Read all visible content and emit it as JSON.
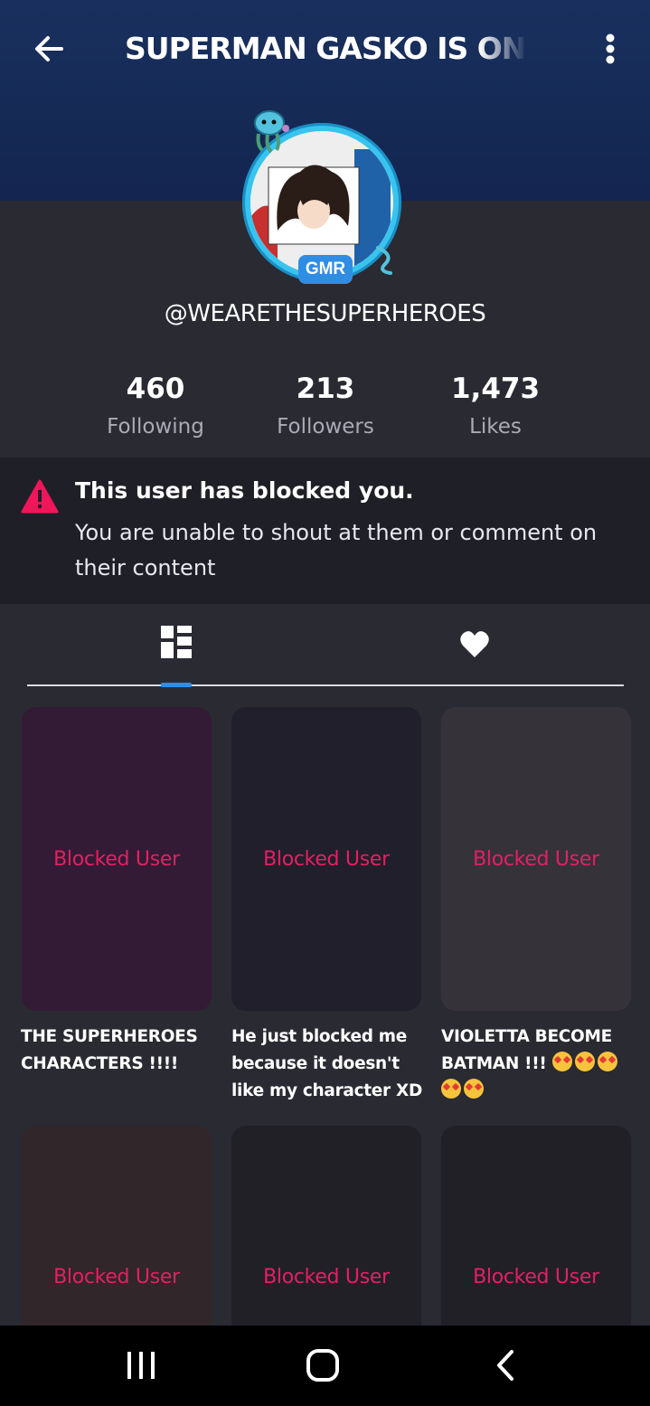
{
  "header": {
    "title": "SUPERMAN GASKO IS ON",
    "back_icon": "arrow-left-icon",
    "menu_icon": "more-vert-icon",
    "background": "#19305e"
  },
  "profile": {
    "badge": "GMR",
    "username": "@WEARETHESUPERHEROES"
  },
  "stats": [
    {
      "value": "460",
      "label": "Following"
    },
    {
      "value": "213",
      "label": "Followers"
    },
    {
      "value": "1,473",
      "label": "Likes"
    }
  ],
  "notice": {
    "icon": "warning-icon",
    "icon_color": "#f0165a",
    "heading": "This user has blocked you.",
    "body": "You are unable to shout at them or comment on their content"
  },
  "tabs": [
    {
      "icon": "grid-layout-icon",
      "active": true
    },
    {
      "icon": "heart-icon",
      "active": false
    }
  ],
  "posts": [
    {
      "label": "Blocked User",
      "caption": "THE SUPERHEROES CHARACTERS !!!!",
      "color": "#331b35"
    },
    {
      "label": "Blocked User",
      "caption": "He just blocked me because it doesn't like my character XD",
      "color": "#211f2c"
    },
    {
      "label": "Blocked User",
      "caption": "VIOLETTA BECOME BATMAN !!!",
      "caption_emoji_count": 5,
      "color": "#36323a"
    },
    {
      "label": "Blocked User",
      "caption": "",
      "color": "#312629"
    },
    {
      "label": "Blocked User",
      "caption": "",
      "color": "#212027"
    },
    {
      "label": "Blocked User",
      "caption": "",
      "color": "#212027"
    }
  ],
  "accent": {
    "blocked_text": "#e51f63",
    "tab_indicator": "#2f8de4"
  },
  "navbar": {
    "recent_icon": "recent-apps-icon",
    "home_icon": "home-icon",
    "back_icon": "back-chevron-icon"
  }
}
